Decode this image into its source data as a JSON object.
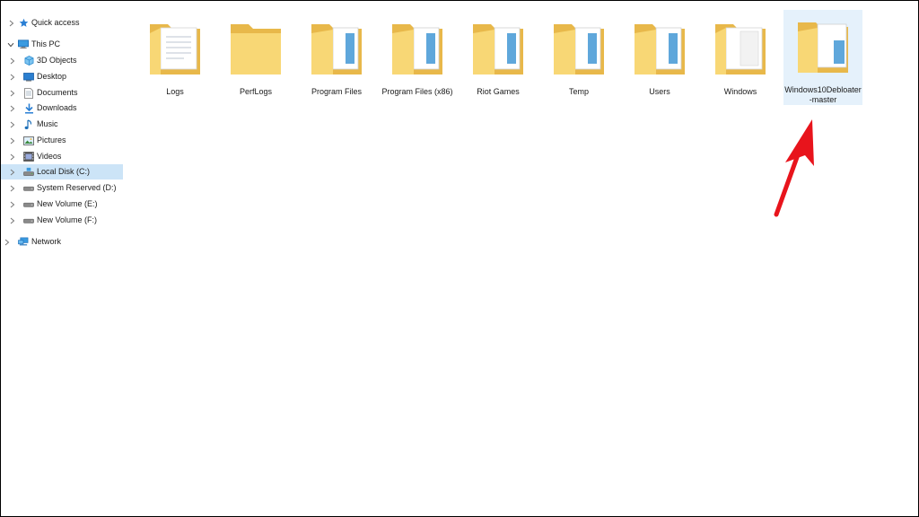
{
  "nav": {
    "items": [
      {
        "label": "Quick access",
        "icon": "star-icon",
        "level": 0
      },
      {
        "label": "This PC",
        "icon": "computer-icon",
        "level": 0,
        "expanded": true
      },
      {
        "label": "3D Objects",
        "icon": "cube-icon",
        "level": 1
      },
      {
        "label": "Desktop",
        "icon": "desktop-icon",
        "level": 1
      },
      {
        "label": "Documents",
        "icon": "document-icon",
        "level": 1
      },
      {
        "label": "Downloads",
        "icon": "download-icon",
        "level": 1
      },
      {
        "label": "Music",
        "icon": "music-icon",
        "level": 1
      },
      {
        "label": "Pictures",
        "icon": "picture-icon",
        "level": 1
      },
      {
        "label": "Videos",
        "icon": "video-icon",
        "level": 1
      },
      {
        "label": "Local Disk (C:)",
        "icon": "drive-icon",
        "level": 1,
        "selected": true
      },
      {
        "label": "System Reserved (D:)",
        "icon": "drive-icon",
        "level": 1
      },
      {
        "label": "New Volume (E:)",
        "icon": "drive-icon",
        "level": 1
      },
      {
        "label": "New Volume (F:)",
        "icon": "drive-icon",
        "level": 1
      },
      {
        "label": "Network",
        "icon": "network-icon",
        "level": 0
      }
    ]
  },
  "content": {
    "folders": [
      {
        "name": "Logs",
        "style": "docs"
      },
      {
        "name": "PerfLogs",
        "style": "empty"
      },
      {
        "name": "Program Files",
        "style": "files"
      },
      {
        "name": "Program Files (x86)",
        "style": "files"
      },
      {
        "name": "Riot Games",
        "style": "files"
      },
      {
        "name": "Temp",
        "style": "files"
      },
      {
        "name": "Users",
        "style": "files"
      },
      {
        "name": "Windows",
        "style": "docs"
      },
      {
        "name": "Windows10Debloater-master",
        "style": "files",
        "selected": true
      }
    ]
  },
  "colors": {
    "folder_back": "#e8b84a",
    "folder_front": "#f8d775",
    "selection": "#cce4f7",
    "annotation_arrow": "#e8141c"
  }
}
